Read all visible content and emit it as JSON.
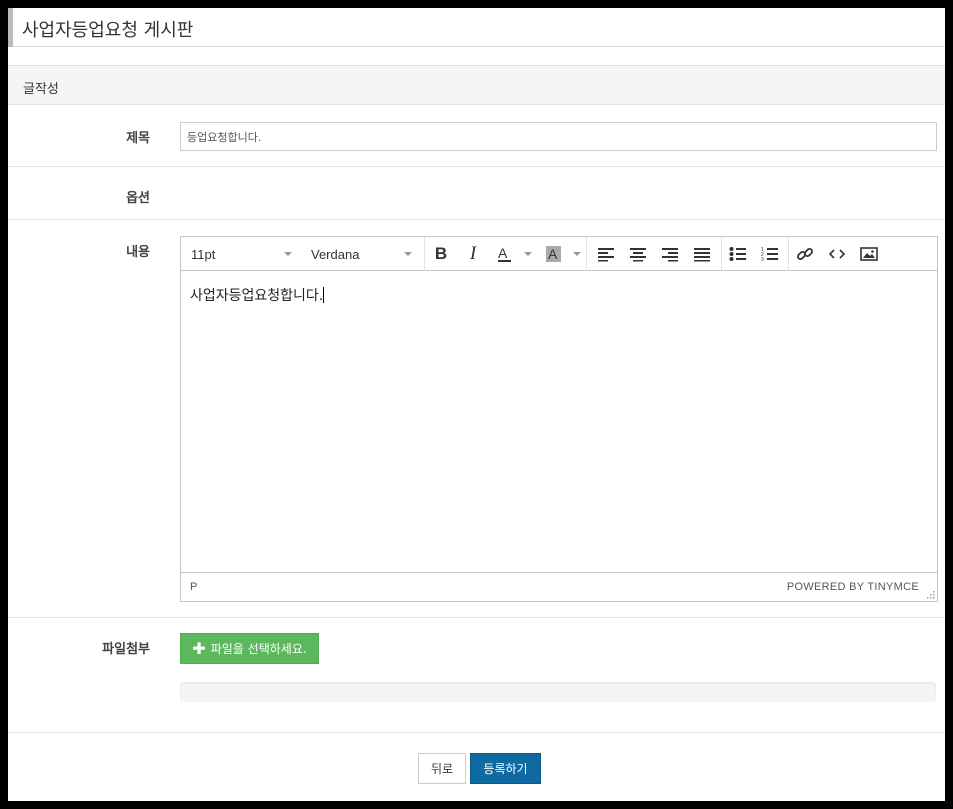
{
  "page": {
    "title": "사업자등업요청 게시판",
    "section_title": "글작성"
  },
  "form": {
    "subject_label": "제목",
    "subject_value": "등업요청합니다.",
    "option_label": "옵션",
    "content_label": "내용",
    "attachment_label": "파일첨부"
  },
  "editor": {
    "font_size": "11pt",
    "font_family": "Verdana",
    "toolbar_icons": [
      "bold-icon",
      "italic-icon",
      "text-color-icon",
      "background-color-icon",
      "align-left-icon",
      "align-center-icon",
      "align-right-icon",
      "align-justify-icon",
      "bullet-list-icon",
      "numbered-list-icon",
      "link-icon",
      "source-code-icon",
      "image-icon"
    ],
    "content": "사업자등업요청합니다.",
    "status_path": "P",
    "powered_by": "POWERED BY TINYMCE"
  },
  "attachment": {
    "button_label": "파일을 선택하세요.",
    "progress": 0
  },
  "actions": {
    "back_label": "뒤로",
    "submit_label": "등록하기"
  },
  "colors": {
    "file_button": "#5cb85c",
    "submit_button": "#0e6aa0"
  }
}
